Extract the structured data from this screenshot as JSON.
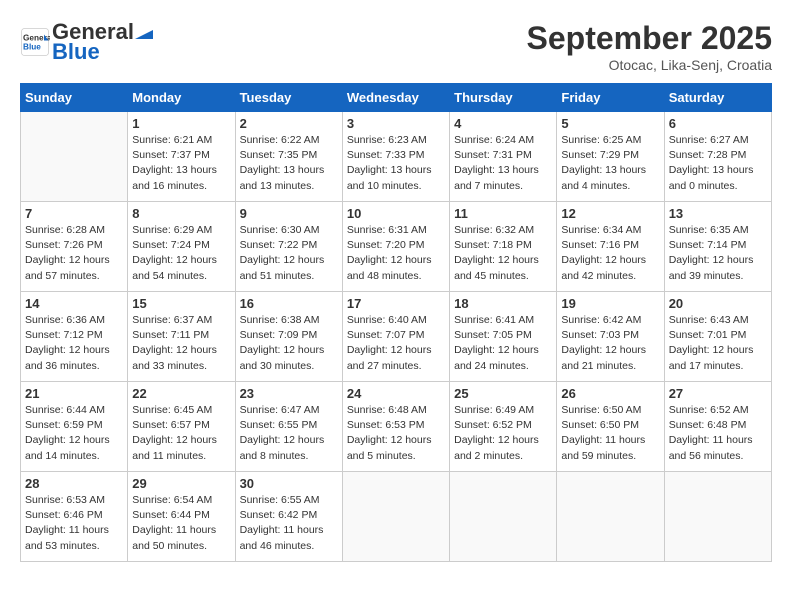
{
  "header": {
    "logo_general": "General",
    "logo_blue": "Blue",
    "month_title": "September 2025",
    "subtitle": "Otocac, Lika-Senj, Croatia"
  },
  "weekdays": [
    "Sunday",
    "Monday",
    "Tuesday",
    "Wednesday",
    "Thursday",
    "Friday",
    "Saturday"
  ],
  "weeks": [
    [
      {
        "day": null,
        "info": null
      },
      {
        "day": "1",
        "info": "Sunrise: 6:21 AM\nSunset: 7:37 PM\nDaylight: 13 hours\nand 16 minutes."
      },
      {
        "day": "2",
        "info": "Sunrise: 6:22 AM\nSunset: 7:35 PM\nDaylight: 13 hours\nand 13 minutes."
      },
      {
        "day": "3",
        "info": "Sunrise: 6:23 AM\nSunset: 7:33 PM\nDaylight: 13 hours\nand 10 minutes."
      },
      {
        "day": "4",
        "info": "Sunrise: 6:24 AM\nSunset: 7:31 PM\nDaylight: 13 hours\nand 7 minutes."
      },
      {
        "day": "5",
        "info": "Sunrise: 6:25 AM\nSunset: 7:29 PM\nDaylight: 13 hours\nand 4 minutes."
      },
      {
        "day": "6",
        "info": "Sunrise: 6:27 AM\nSunset: 7:28 PM\nDaylight: 13 hours\nand 0 minutes."
      }
    ],
    [
      {
        "day": "7",
        "info": "Sunrise: 6:28 AM\nSunset: 7:26 PM\nDaylight: 12 hours\nand 57 minutes."
      },
      {
        "day": "8",
        "info": "Sunrise: 6:29 AM\nSunset: 7:24 PM\nDaylight: 12 hours\nand 54 minutes."
      },
      {
        "day": "9",
        "info": "Sunrise: 6:30 AM\nSunset: 7:22 PM\nDaylight: 12 hours\nand 51 minutes."
      },
      {
        "day": "10",
        "info": "Sunrise: 6:31 AM\nSunset: 7:20 PM\nDaylight: 12 hours\nand 48 minutes."
      },
      {
        "day": "11",
        "info": "Sunrise: 6:32 AM\nSunset: 7:18 PM\nDaylight: 12 hours\nand 45 minutes."
      },
      {
        "day": "12",
        "info": "Sunrise: 6:34 AM\nSunset: 7:16 PM\nDaylight: 12 hours\nand 42 minutes."
      },
      {
        "day": "13",
        "info": "Sunrise: 6:35 AM\nSunset: 7:14 PM\nDaylight: 12 hours\nand 39 minutes."
      }
    ],
    [
      {
        "day": "14",
        "info": "Sunrise: 6:36 AM\nSunset: 7:12 PM\nDaylight: 12 hours\nand 36 minutes."
      },
      {
        "day": "15",
        "info": "Sunrise: 6:37 AM\nSunset: 7:11 PM\nDaylight: 12 hours\nand 33 minutes."
      },
      {
        "day": "16",
        "info": "Sunrise: 6:38 AM\nSunset: 7:09 PM\nDaylight: 12 hours\nand 30 minutes."
      },
      {
        "day": "17",
        "info": "Sunrise: 6:40 AM\nSunset: 7:07 PM\nDaylight: 12 hours\nand 27 minutes."
      },
      {
        "day": "18",
        "info": "Sunrise: 6:41 AM\nSunset: 7:05 PM\nDaylight: 12 hours\nand 24 minutes."
      },
      {
        "day": "19",
        "info": "Sunrise: 6:42 AM\nSunset: 7:03 PM\nDaylight: 12 hours\nand 21 minutes."
      },
      {
        "day": "20",
        "info": "Sunrise: 6:43 AM\nSunset: 7:01 PM\nDaylight: 12 hours\nand 17 minutes."
      }
    ],
    [
      {
        "day": "21",
        "info": "Sunrise: 6:44 AM\nSunset: 6:59 PM\nDaylight: 12 hours\nand 14 minutes."
      },
      {
        "day": "22",
        "info": "Sunrise: 6:45 AM\nSunset: 6:57 PM\nDaylight: 12 hours\nand 11 minutes."
      },
      {
        "day": "23",
        "info": "Sunrise: 6:47 AM\nSunset: 6:55 PM\nDaylight: 12 hours\nand 8 minutes."
      },
      {
        "day": "24",
        "info": "Sunrise: 6:48 AM\nSunset: 6:53 PM\nDaylight: 12 hours\nand 5 minutes."
      },
      {
        "day": "25",
        "info": "Sunrise: 6:49 AM\nSunset: 6:52 PM\nDaylight: 12 hours\nand 2 minutes."
      },
      {
        "day": "26",
        "info": "Sunrise: 6:50 AM\nSunset: 6:50 PM\nDaylight: 11 hours\nand 59 minutes."
      },
      {
        "day": "27",
        "info": "Sunrise: 6:52 AM\nSunset: 6:48 PM\nDaylight: 11 hours\nand 56 minutes."
      }
    ],
    [
      {
        "day": "28",
        "info": "Sunrise: 6:53 AM\nSunset: 6:46 PM\nDaylight: 11 hours\nand 53 minutes."
      },
      {
        "day": "29",
        "info": "Sunrise: 6:54 AM\nSunset: 6:44 PM\nDaylight: 11 hours\nand 50 minutes."
      },
      {
        "day": "30",
        "info": "Sunrise: 6:55 AM\nSunset: 6:42 PM\nDaylight: 11 hours\nand 46 minutes."
      },
      {
        "day": null,
        "info": null
      },
      {
        "day": null,
        "info": null
      },
      {
        "day": null,
        "info": null
      },
      {
        "day": null,
        "info": null
      }
    ]
  ]
}
